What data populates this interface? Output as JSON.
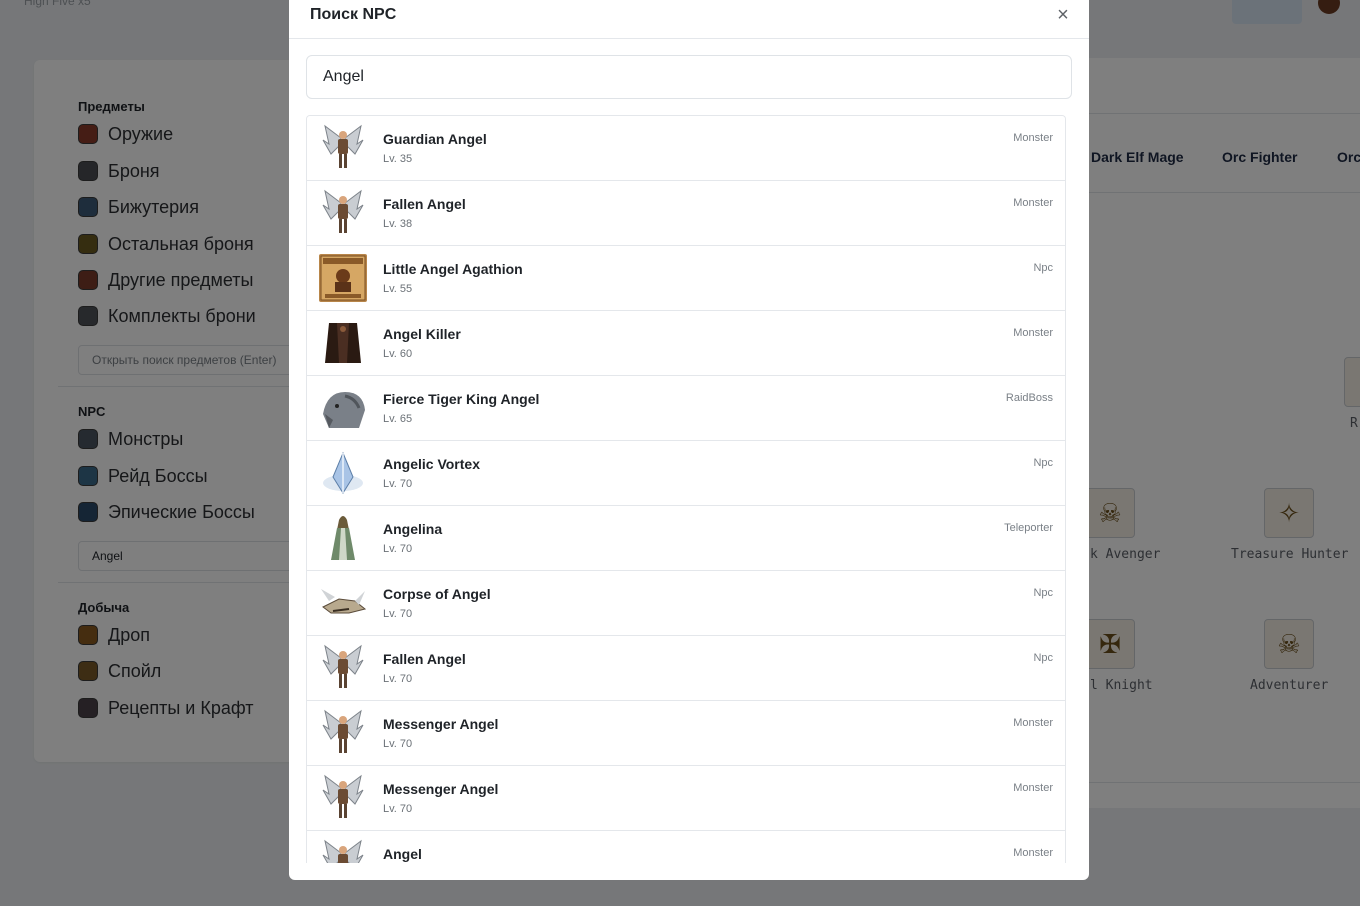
{
  "background": {
    "brand": "High Five x5",
    "sidebar": {
      "items_title": "Предметы",
      "items": [
        "Оружие",
        "Броня",
        "Бижутерия",
        "Остальная броня",
        "Другие предметы",
        "Комплекты брони"
      ],
      "items_search_placeholder": "Открыть поиск предметов (Enter)",
      "npc_title": "NPC",
      "npc_items": [
        "Монстры",
        "Рейд Боссы",
        "Эпические Боссы"
      ],
      "npc_search_value": "Angel",
      "loot_title": "Добыча",
      "loot_items": [
        "Дроп",
        "Спойл",
        "Рецепты и Крафт"
      ]
    },
    "race_tabs": [
      "Dark Elf Mage",
      "Orc Fighter",
      "Orc"
    ],
    "classes": [
      "k Avenger",
      "Treasure Hunter",
      "l Knight",
      "Adventurer"
    ],
    "edge_text": "R"
  },
  "modal": {
    "title": "Поиск NPC",
    "close_symbol": "×",
    "search_value": "Angel",
    "results": [
      {
        "name": "Guardian Angel",
        "level": "Lv. 35",
        "type": "Monster",
        "thumb": "angel"
      },
      {
        "name": "Fallen Angel",
        "level": "Lv. 38",
        "type": "Monster",
        "thumb": "angel"
      },
      {
        "name": "Little Angel Agathion",
        "level": "Lv. 55",
        "type": "Npc",
        "thumb": "wanted"
      },
      {
        "name": "Angel Killer",
        "level": "Lv. 60",
        "type": "Monster",
        "thumb": "dark"
      },
      {
        "name": "Fierce Tiger King Angel",
        "level": "Lv. 65",
        "type": "RaidBoss",
        "thumb": "beast"
      },
      {
        "name": "Angelic Vortex",
        "level": "Lv. 70",
        "type": "Npc",
        "thumb": "crystal"
      },
      {
        "name": "Angelina",
        "level": "Lv. 70",
        "type": "Teleporter",
        "thumb": "robe"
      },
      {
        "name": "Corpse of Angel",
        "level": "Lv. 70",
        "type": "Npc",
        "thumb": "corpse"
      },
      {
        "name": "Fallen Angel",
        "level": "Lv. 70",
        "type": "Npc",
        "thumb": "angel"
      },
      {
        "name": "Messenger Angel",
        "level": "Lv. 70",
        "type": "Monster",
        "thumb": "angel"
      },
      {
        "name": "Messenger Angel",
        "level": "Lv. 70",
        "type": "Monster",
        "thumb": "angel"
      },
      {
        "name": "Angel",
        "level": "",
        "type": "Monster",
        "thumb": "angel"
      }
    ]
  }
}
